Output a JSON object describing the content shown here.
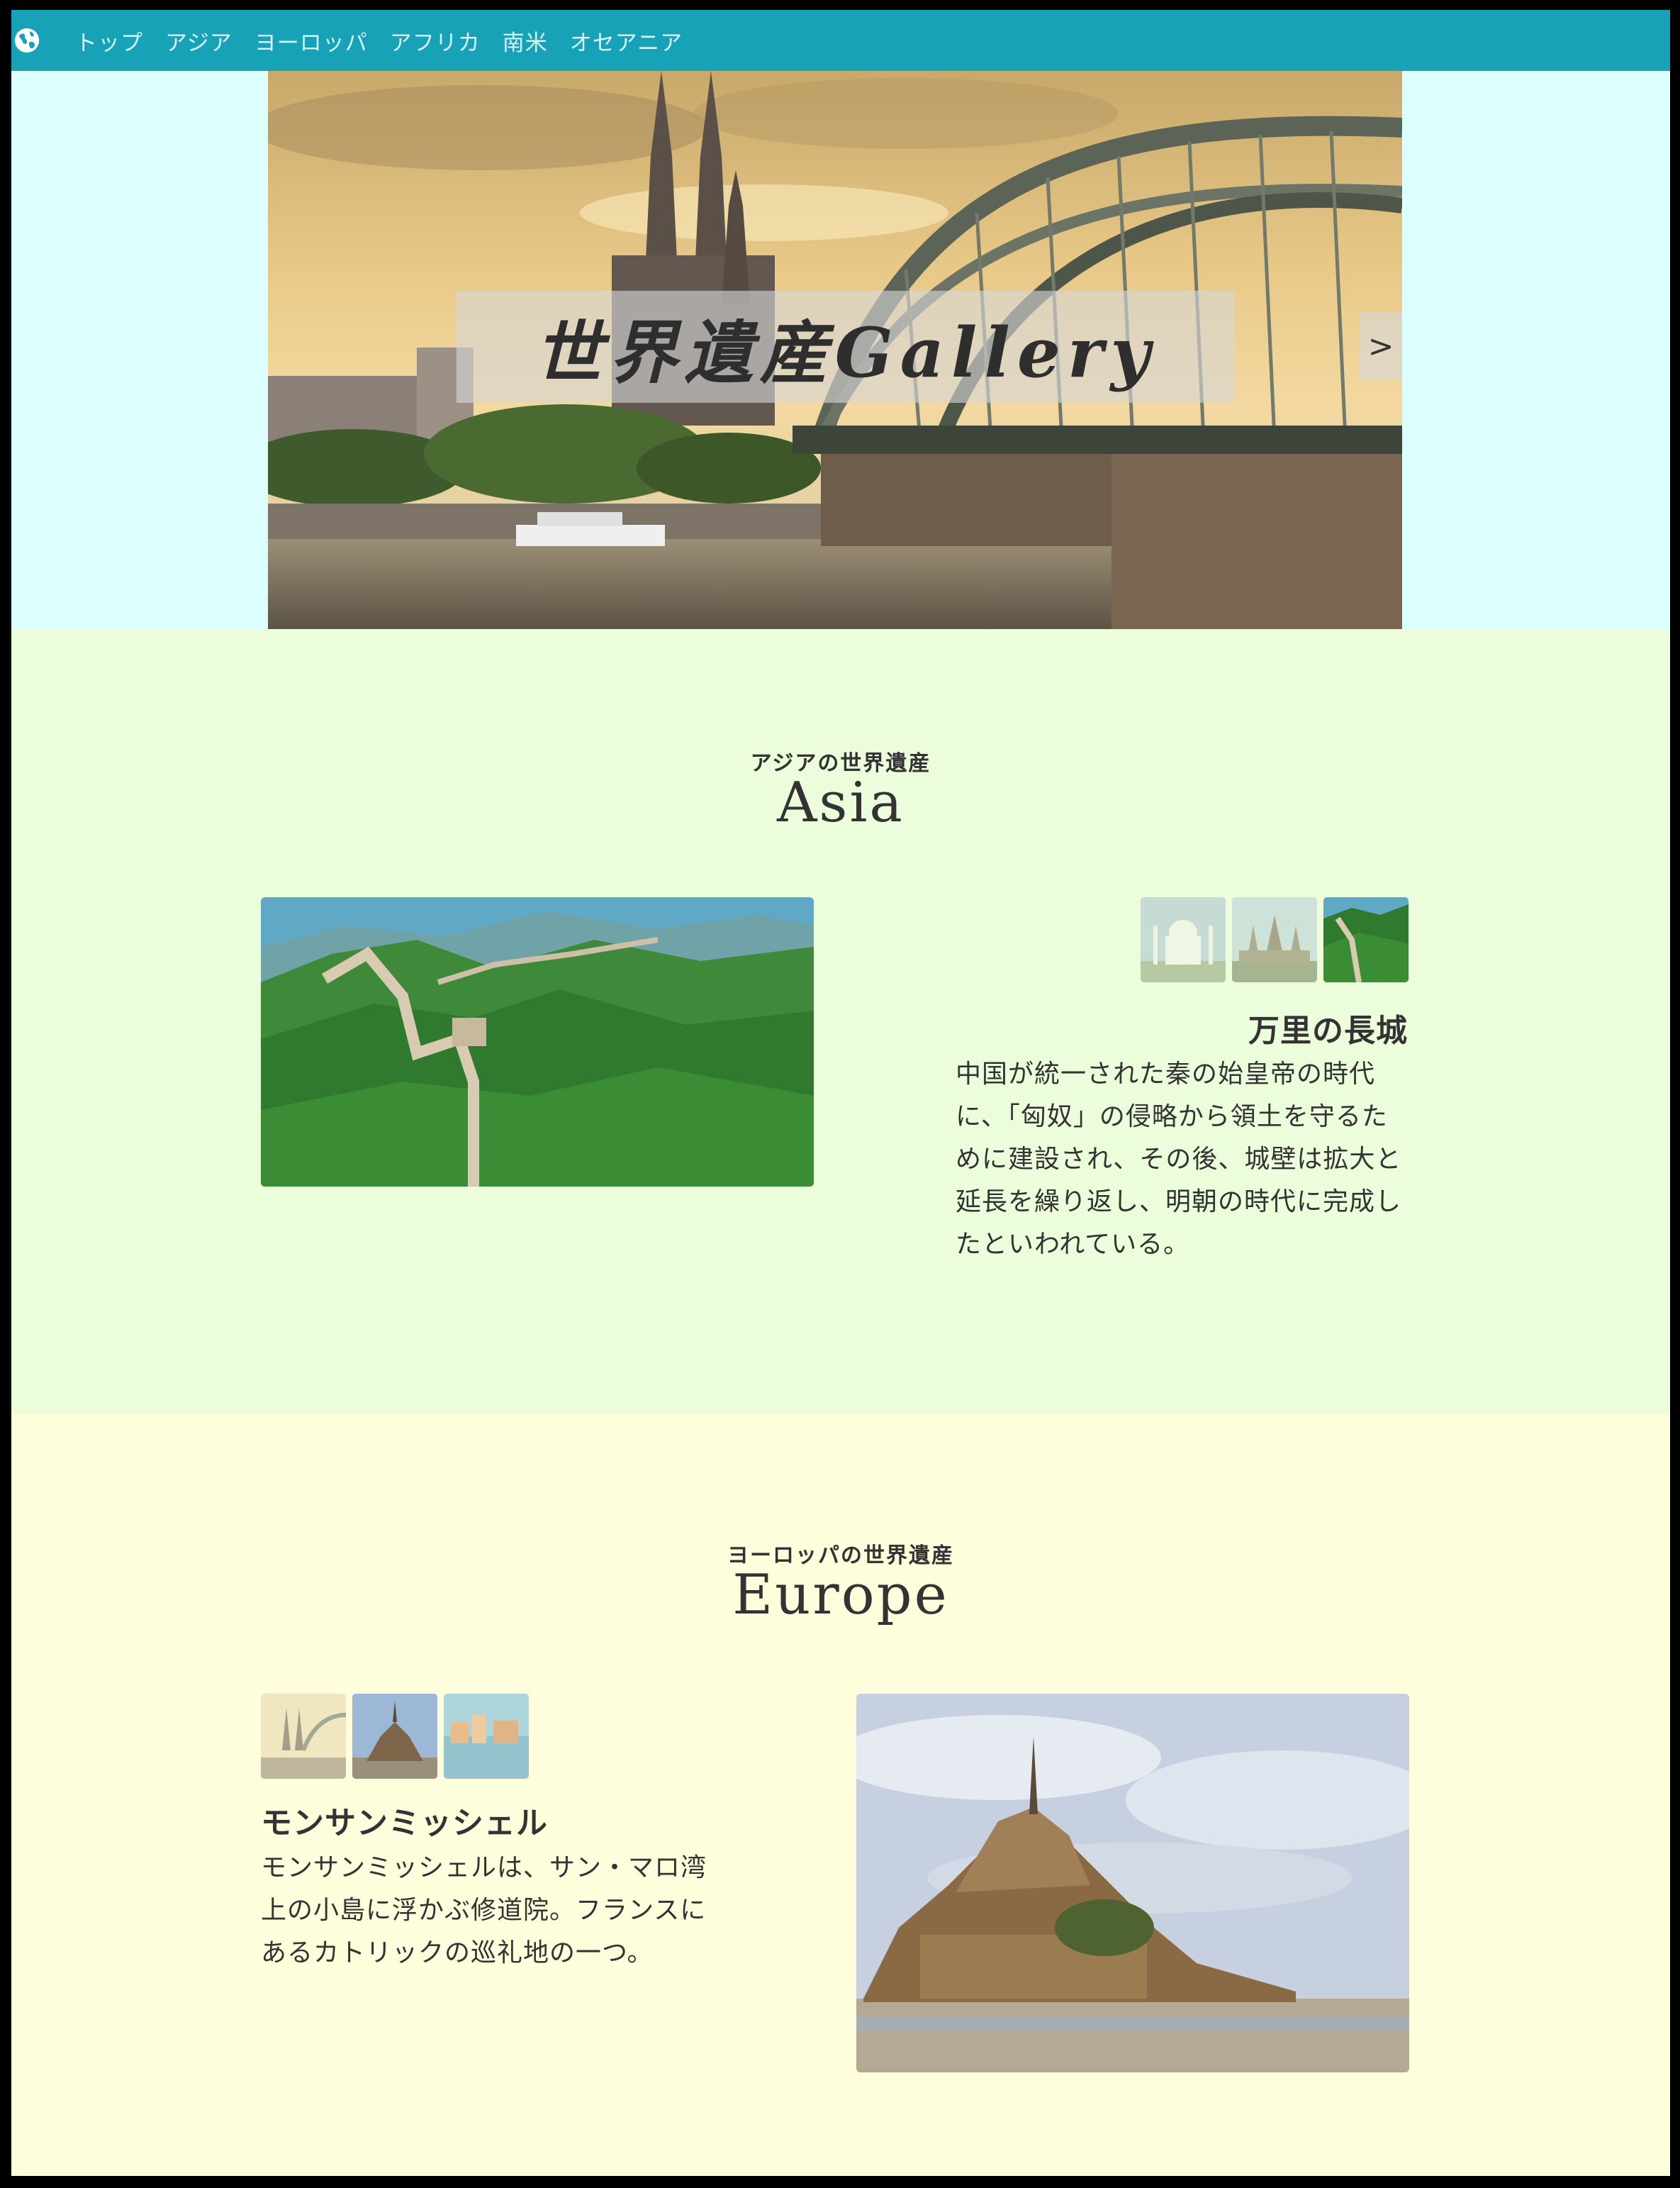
{
  "nav": {
    "icon": "globe-icon",
    "items": [
      "トップ",
      "アジア",
      "ヨーロッパ",
      "アフリカ",
      "南米",
      "オセアニア"
    ]
  },
  "hero": {
    "title": "世界遺産Gallery",
    "next_label": ">"
  },
  "asia": {
    "subtitle": "アジアの世界遺産",
    "heading": "Asia",
    "place_title": "万里の長城",
    "description": "中国が統一された秦の始皇帝の時代に、「匈奴」の侵略から領土を守るために建設され、その後、城壁は拡大と延長を繰り返し、明朝の時代に完成したといわれている。"
  },
  "europe": {
    "subtitle": "ヨーロッパの世界遺産",
    "heading": "Europe",
    "place_title": "モンサンミッシェル",
    "description": "モンサンミッシェルは、サン・マロ湾上の小島に浮かぶ修道院。フランスにあるカトリックの巡礼地の一つ。"
  },
  "colors": {
    "nav": "#17a2b8",
    "hero_bg": "#dcfffe",
    "asia_bg": "#ebfddb",
    "europe_bg": "#fefedc"
  }
}
